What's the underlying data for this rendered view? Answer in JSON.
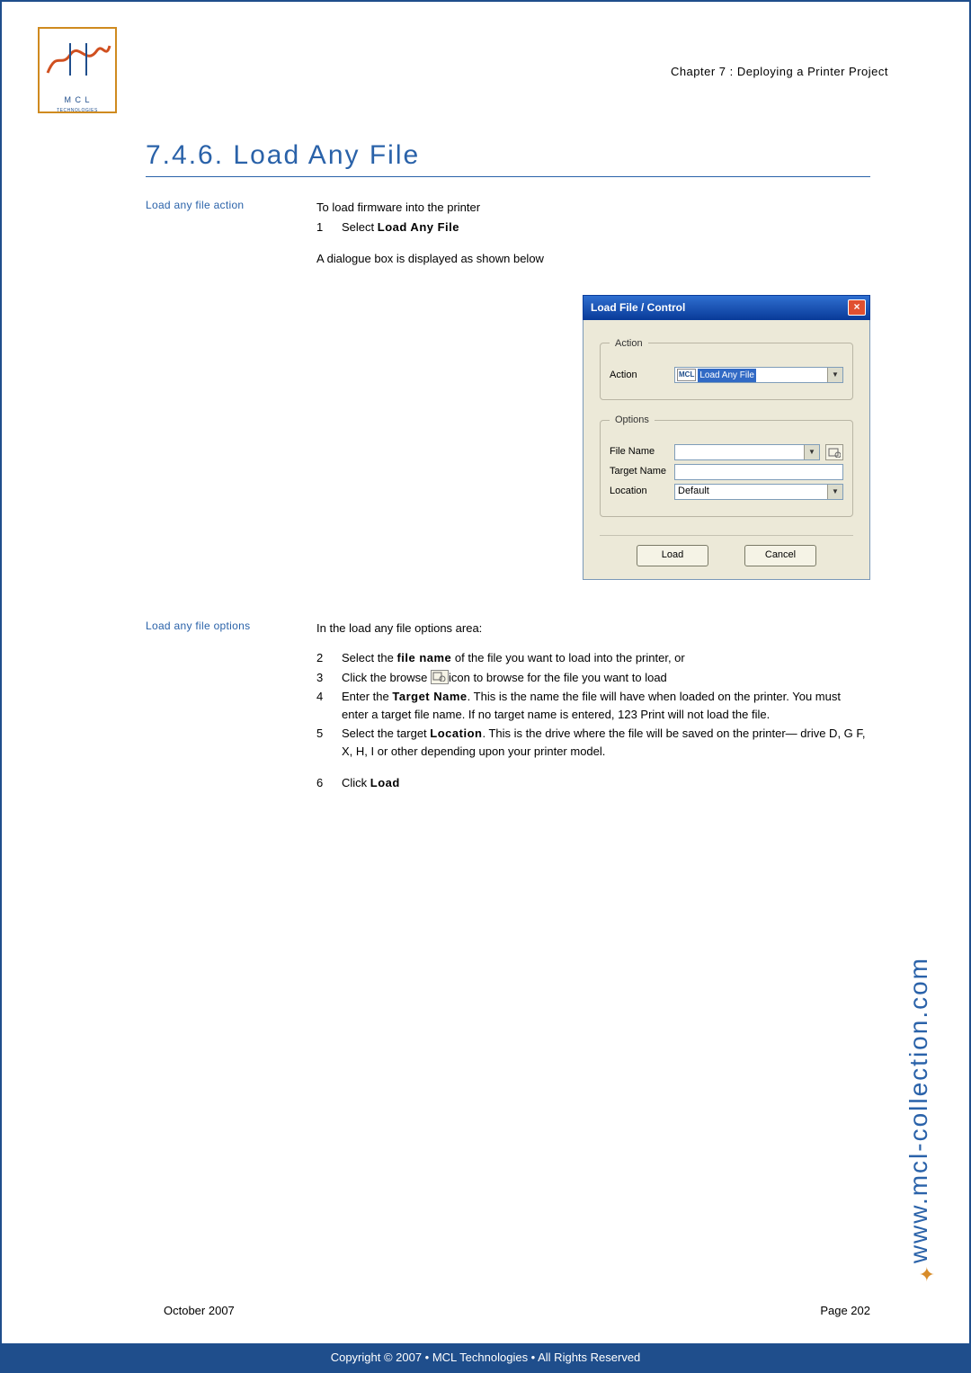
{
  "header": {
    "chapter": "Chapter 7 : Deploying a Printer Project",
    "logo": {
      "line1": "M C L",
      "line2": "TECHNOLOGIES"
    }
  },
  "title": "7.4.6.   Load Any File",
  "section1": {
    "side": "Load any file action",
    "intro": "To load firmware into the printer",
    "step1_n": "1",
    "step1_pre": "Select ",
    "step1_bold": "Load Any File",
    "after": "A dialogue box is displayed as shown below"
  },
  "dialog": {
    "title": "Load File / Control",
    "group_action": "Action",
    "label_action": "Action",
    "action_value": "Load Any File",
    "group_options": "Options",
    "label_filename": "File Name",
    "label_target": "Target Name",
    "label_location": "Location",
    "location_value": "Default",
    "btn_load": "Load",
    "btn_cancel": "Cancel"
  },
  "section2": {
    "side": "Load any file options",
    "intro": "In the load any file options area:",
    "s2": {
      "n": "2",
      "pre": "Select the ",
      "b": "file name",
      "post": " of the file you want to load into the printer, or"
    },
    "s3": {
      "n": "3",
      "pre": "Click the browse ",
      "post": "icon to browse for the file you want to load"
    },
    "s4": {
      "n": "4",
      "pre": "Enter the ",
      "b": "Target Name",
      "post": ". This is the name the file will have when loaded on the printer. You must enter a target file name. If no target name is entered, 123 Print will not load the file."
    },
    "s5": {
      "n": "5",
      "pre": "Select the target ",
      "b": "Location",
      "post": ". This is the drive where the file will be saved on the printer— drive D, G F, X, H, I or other depending upon your printer model."
    },
    "s6": {
      "n": "6",
      "pre": "Click ",
      "b": "Load"
    }
  },
  "footer": {
    "date": "October 2007",
    "page": "Page 202",
    "copyright": "Copyright © 2007 • MCL Technologies • All Rights Reserved",
    "url": "www.mcl-collection.com"
  }
}
